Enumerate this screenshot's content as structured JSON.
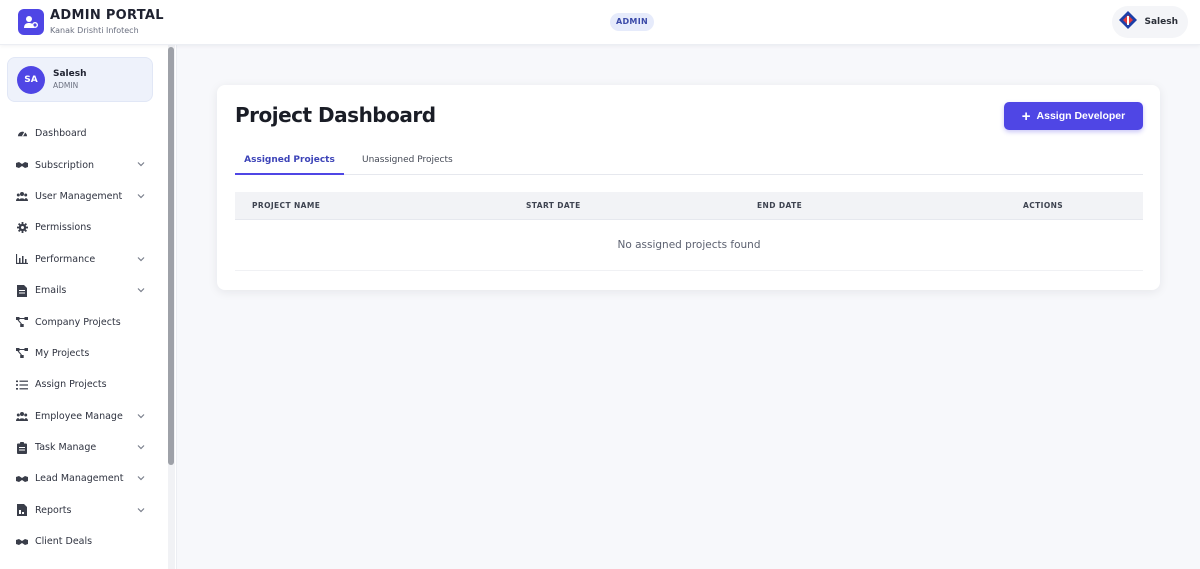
{
  "header": {
    "app_title": "ADMIN PORTAL",
    "company": "Kanak Drishti Infotech",
    "role_badge": "ADMIN",
    "user_name": "Salesh"
  },
  "sidebar": {
    "profile": {
      "initials": "SA",
      "name": "Salesh",
      "role": "ADMIN"
    },
    "items": [
      {
        "label": "Dashboard",
        "icon": "gauge-icon",
        "has_chevron": false
      },
      {
        "label": "Subscription",
        "icon": "handshake-icon",
        "has_chevron": true
      },
      {
        "label": "User Management",
        "icon": "users-icon",
        "has_chevron": true
      },
      {
        "label": "Permissions",
        "icon": "gear-icon",
        "has_chevron": false
      },
      {
        "label": "Performance",
        "icon": "chart-line-icon",
        "has_chevron": true
      },
      {
        "label": "Emails",
        "icon": "file-icon",
        "has_chevron": true
      },
      {
        "label": "Company Projects",
        "icon": "diagram-icon",
        "has_chevron": false
      },
      {
        "label": "My Projects",
        "icon": "diagram-icon",
        "has_chevron": false
      },
      {
        "label": "Assign Projects",
        "icon": "list-check-icon",
        "has_chevron": false
      },
      {
        "label": "Employee Manage",
        "icon": "users-icon",
        "has_chevron": true
      },
      {
        "label": "Task Manage",
        "icon": "clipboard-icon",
        "has_chevron": true
      },
      {
        "label": "Lead Management",
        "icon": "handshake-icon",
        "has_chevron": true
      },
      {
        "label": "Reports",
        "icon": "file-invoice-icon",
        "has_chevron": true
      },
      {
        "label": "Client Deals",
        "icon": "handshake-icon",
        "has_chevron": false
      }
    ]
  },
  "main": {
    "title": "Project Dashboard",
    "assign_button": "Assign Developer",
    "tabs": [
      {
        "label": "Assigned Projects",
        "active": true
      },
      {
        "label": "Unassigned Projects",
        "active": false
      }
    ],
    "table": {
      "columns": [
        "PROJECT NAME",
        "START DATE",
        "END DATE",
        "ACTIONS"
      ],
      "empty_message": "No assigned projects found"
    }
  },
  "colors": {
    "accent": "#4f46e5",
    "background": "#f7f8fb"
  }
}
